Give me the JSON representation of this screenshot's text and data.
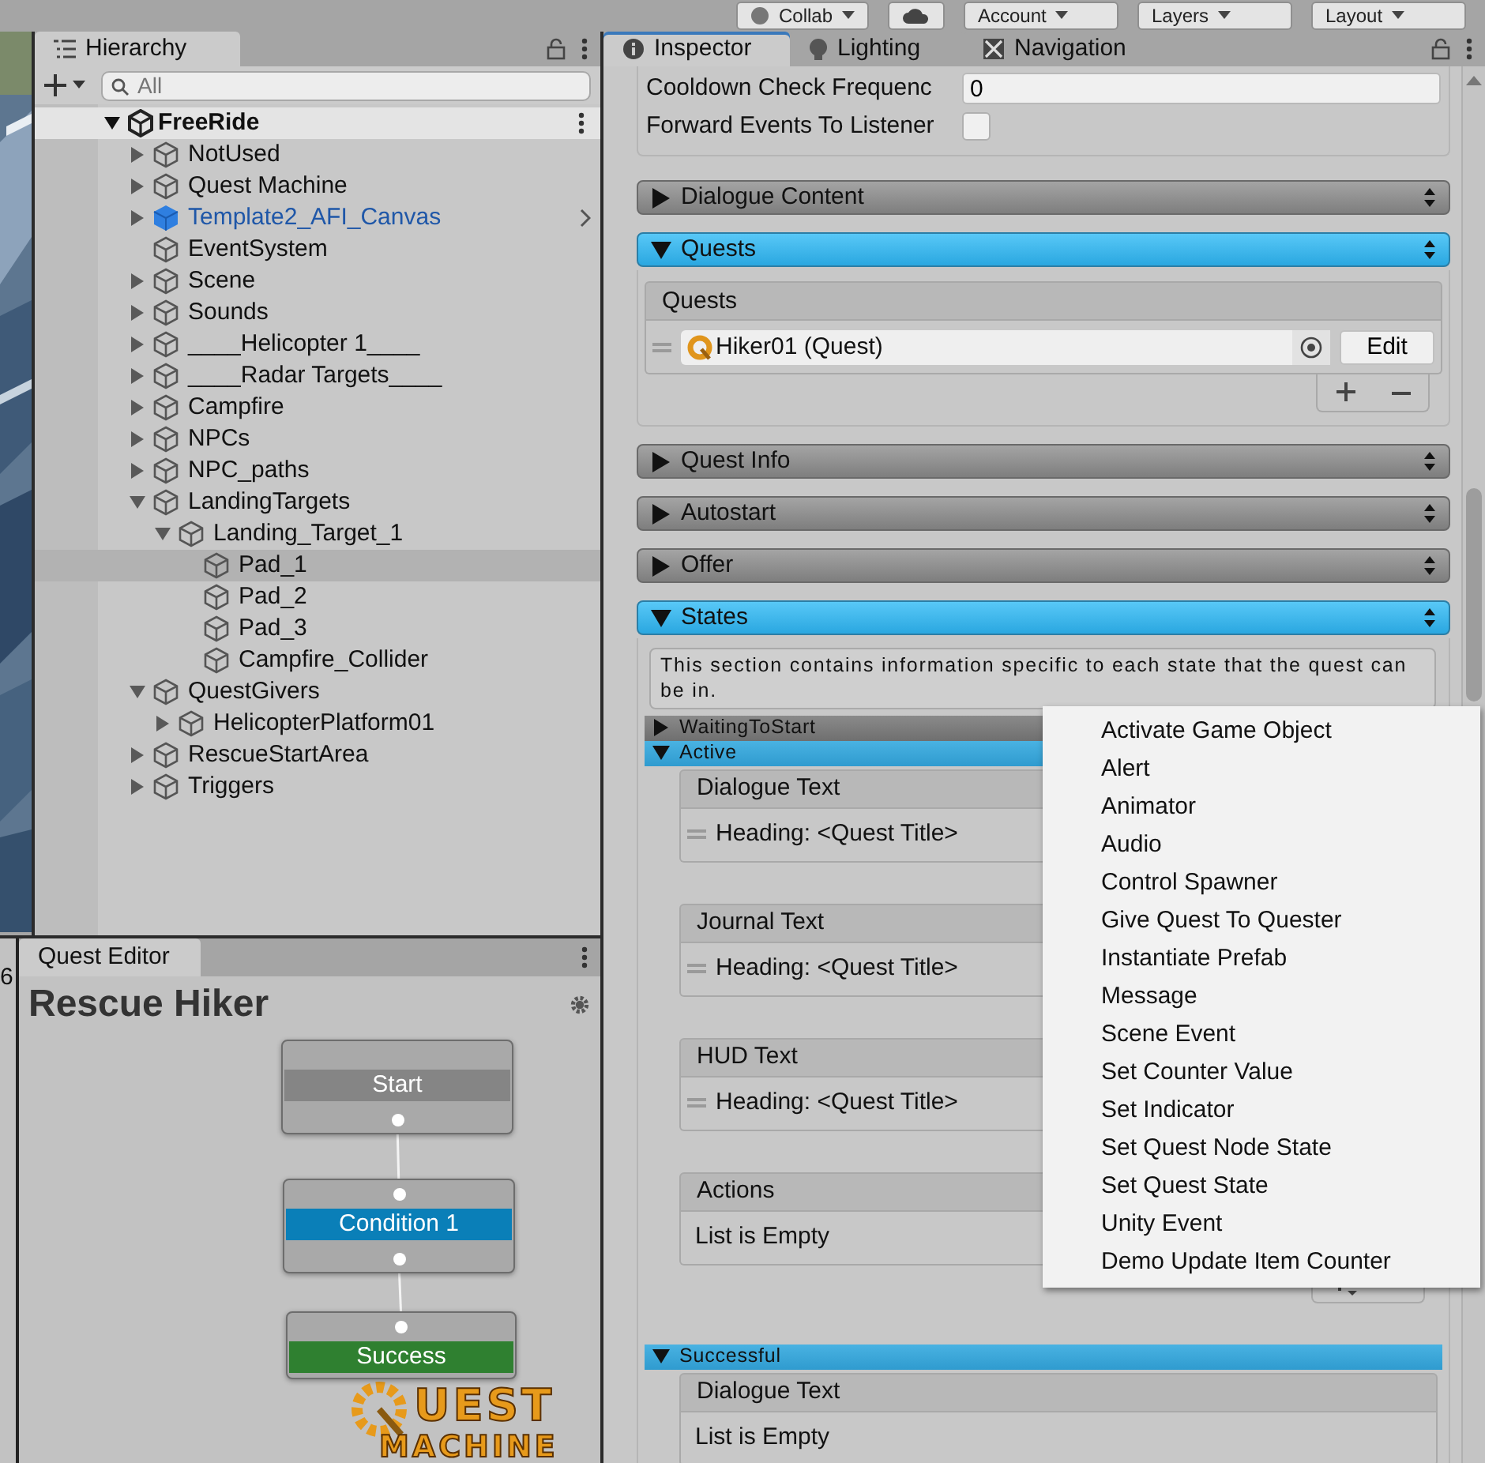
{
  "toolbar": {
    "buttons": [
      {
        "label": "Collab",
        "kind": "collab"
      },
      {
        "kind": "cloud"
      },
      {
        "label": "Account",
        "kind": "menu"
      },
      {
        "label": "Layers",
        "kind": "menu"
      },
      {
        "label": "Layout",
        "kind": "menu"
      }
    ]
  },
  "hierarchy": {
    "tab": "Hierarchy",
    "search": {
      "placeholder": "All"
    },
    "scene": {
      "name": "FreeRide",
      "expanded": true
    },
    "items": [
      {
        "name": "NotUsed",
        "kind": "object",
        "expanded": false,
        "selected": false
      },
      {
        "name": "Quest Machine",
        "kind": "object",
        "expanded": false,
        "selected": false
      },
      {
        "name": "Template2_AFI_Canvas",
        "kind": "prefab",
        "expanded": false,
        "selected": false
      },
      {
        "name": "EventSystem",
        "kind": "object",
        "selected": false
      },
      {
        "name": "Scene",
        "kind": "object",
        "expanded": false,
        "selected": false
      },
      {
        "name": "Sounds",
        "kind": "object",
        "expanded": false,
        "selected": false
      },
      {
        "name": "____Helicopter 1____",
        "kind": "object",
        "expanded": false,
        "selected": false
      },
      {
        "name": "____Radar Targets____",
        "kind": "object",
        "expanded": false,
        "selected": false
      },
      {
        "name": "Campfire",
        "kind": "object",
        "expanded": false,
        "selected": false
      },
      {
        "name": "NPCs",
        "kind": "object",
        "expanded": false,
        "selected": false
      },
      {
        "name": "NPC_paths",
        "kind": "object",
        "expanded": false,
        "selected": false
      },
      {
        "name": "LandingTargets",
        "kind": "object",
        "expanded": true,
        "selected": false,
        "children": [
          {
            "name": "Landing_Target_1",
            "kind": "object",
            "expanded": true,
            "selected": false,
            "children": [
              {
                "name": "Pad_1",
                "kind": "object",
                "selected": true
              },
              {
                "name": "Pad_2",
                "kind": "object",
                "selected": false
              },
              {
                "name": "Pad_3",
                "kind": "object",
                "selected": false
              },
              {
                "name": "Campfire_Collider",
                "kind": "object",
                "selected": false
              }
            ]
          }
        ]
      },
      {
        "name": "QuestGivers",
        "kind": "object",
        "expanded": true,
        "selected": false,
        "children": [
          {
            "name": "HelicopterPlatform01",
            "kind": "object",
            "expanded": false,
            "selected": false
          }
        ]
      },
      {
        "name": "RescueStartArea",
        "kind": "object",
        "expanded": false,
        "selected": false
      },
      {
        "name": "Triggers",
        "kind": "object",
        "expanded": false,
        "selected": false
      }
    ]
  },
  "side_fragment": "6",
  "quest_editor": {
    "tab": "Quest Editor",
    "title": "Rescue Hiker",
    "nodes": [
      {
        "label": "Start",
        "kind": "start"
      },
      {
        "label": "Condition 1",
        "kind": "condition"
      },
      {
        "label": "Success",
        "kind": "success"
      }
    ],
    "logo": [
      "UEST",
      "MACHINE"
    ]
  },
  "inspector": {
    "tabs": [
      {
        "label": "Inspector",
        "kind": "info",
        "selected": true
      },
      {
        "label": "Lighting",
        "kind": "bulb",
        "selected": false
      },
      {
        "label": "Navigation",
        "kind": "nav",
        "selected": false
      }
    ],
    "fields": [
      {
        "label": "Cooldown Check Frequenc",
        "kind": "text",
        "value": "0"
      },
      {
        "label": "Forward Events To Listener",
        "kind": "checkbox",
        "checked": false
      }
    ],
    "sections": [
      {
        "title": "Dialogue Content",
        "expanded": false
      },
      {
        "title": "Quests",
        "expanded": true,
        "kind": "quests",
        "list_title": "Quests",
        "items": [
          "Hiker01 (Quest)"
        ],
        "edit": "Edit"
      },
      {
        "title": "Quest Info",
        "expanded": false
      },
      {
        "title": "Autostart",
        "expanded": false
      },
      {
        "title": "Offer",
        "expanded": false
      },
      {
        "title": "States",
        "expanded": true,
        "kind": "states",
        "help": "This section contains information specific to each state that the quest can be in.",
        "states": [
          {
            "name": "WaitingToStart",
            "expanded": false
          },
          {
            "name": "Active",
            "expanded": true,
            "lists": [
              {
                "title": "Dialogue Text",
                "kind": "text",
                "items": [
                  "Heading: <Quest Title>"
                ]
              },
              {
                "title": "Journal Text",
                "kind": "text",
                "items": [
                  "Heading: <Quest Title>"
                ]
              },
              {
                "title": "HUD Text",
                "kind": "text",
                "items": [
                  "Heading: <Quest Title>"
                ]
              },
              {
                "title": "Actions",
                "kind": "actions",
                "empty": "List is Empty"
              }
            ]
          },
          {
            "name": "Successful",
            "expanded": true,
            "lists": [
              {
                "title": "Dialogue Text",
                "kind": "text",
                "empty": "List is Empty"
              }
            ]
          }
        ]
      }
    ]
  },
  "menu": {
    "items": [
      "Activate Game Object",
      "Alert",
      "Animator",
      "Audio",
      "Control Spawner",
      "Give Quest To Quester",
      "Instantiate Prefab",
      "Message",
      "Scene Event",
      "Set Counter Value",
      "Set Indicator",
      "Set Quest Node State",
      "Set Quest State",
      "Unity Event",
      "Demo Update Item Counter"
    ]
  }
}
